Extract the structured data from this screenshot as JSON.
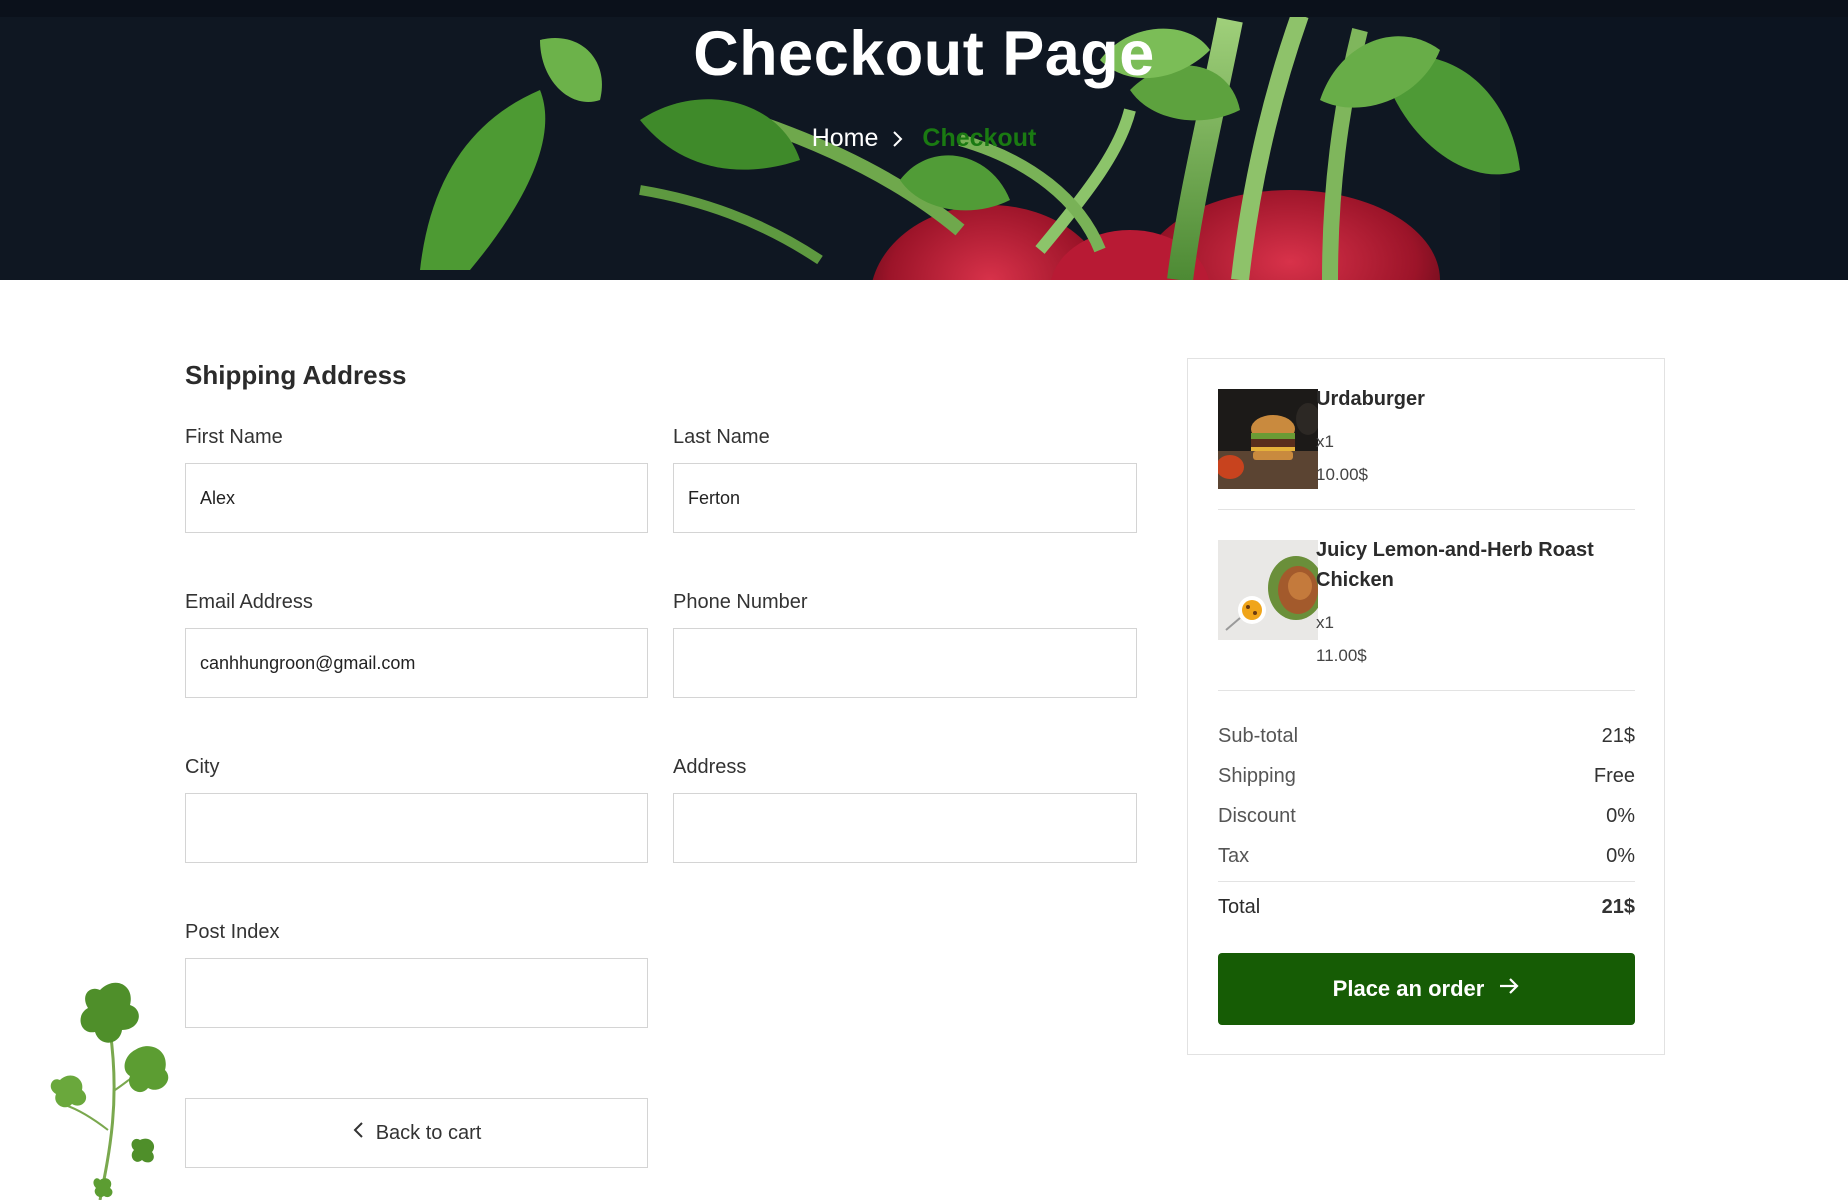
{
  "hero": {
    "title": "Checkout Page",
    "breadcrumb": {
      "home": "Home",
      "current": "Checkout"
    }
  },
  "form": {
    "section_title": "Shipping Address",
    "fields": {
      "first_name": {
        "label": "First Name",
        "value": "Alex"
      },
      "last_name": {
        "label": "Last Name",
        "value": "Ferton"
      },
      "email": {
        "label": "Email Address",
        "value": "canhhungroon@gmail.com"
      },
      "phone": {
        "label": "Phone Number",
        "value": ""
      },
      "city": {
        "label": "City",
        "value": ""
      },
      "address": {
        "label": "Address",
        "value": ""
      },
      "post_index": {
        "label": "Post Index",
        "value": ""
      }
    },
    "back_label": "Back to cart"
  },
  "summary": {
    "items": [
      {
        "name": "Urdaburger",
        "qty": "x1",
        "price": "10.00$",
        "image": "burger-image"
      },
      {
        "name": "Juicy Lemon-and-Herb Roast Chicken",
        "qty": "x1",
        "price": "11.00$",
        "image": "roast-chicken-image"
      }
    ],
    "rows": {
      "subtotal": {
        "label": "Sub-total",
        "value": "21$"
      },
      "shipping": {
        "label": "Shipping",
        "value": "Free"
      },
      "discount": {
        "label": "Discount",
        "value": "0%"
      },
      "tax": {
        "label": "Tax",
        "value": "0%"
      },
      "total": {
        "label": "Total",
        "value": "21$"
      }
    },
    "order_label": "Place an order"
  },
  "colors": {
    "accent_green": "#165c05",
    "breadcrumb_green": "#1a7a12",
    "hero_bg": "#0f1722"
  }
}
